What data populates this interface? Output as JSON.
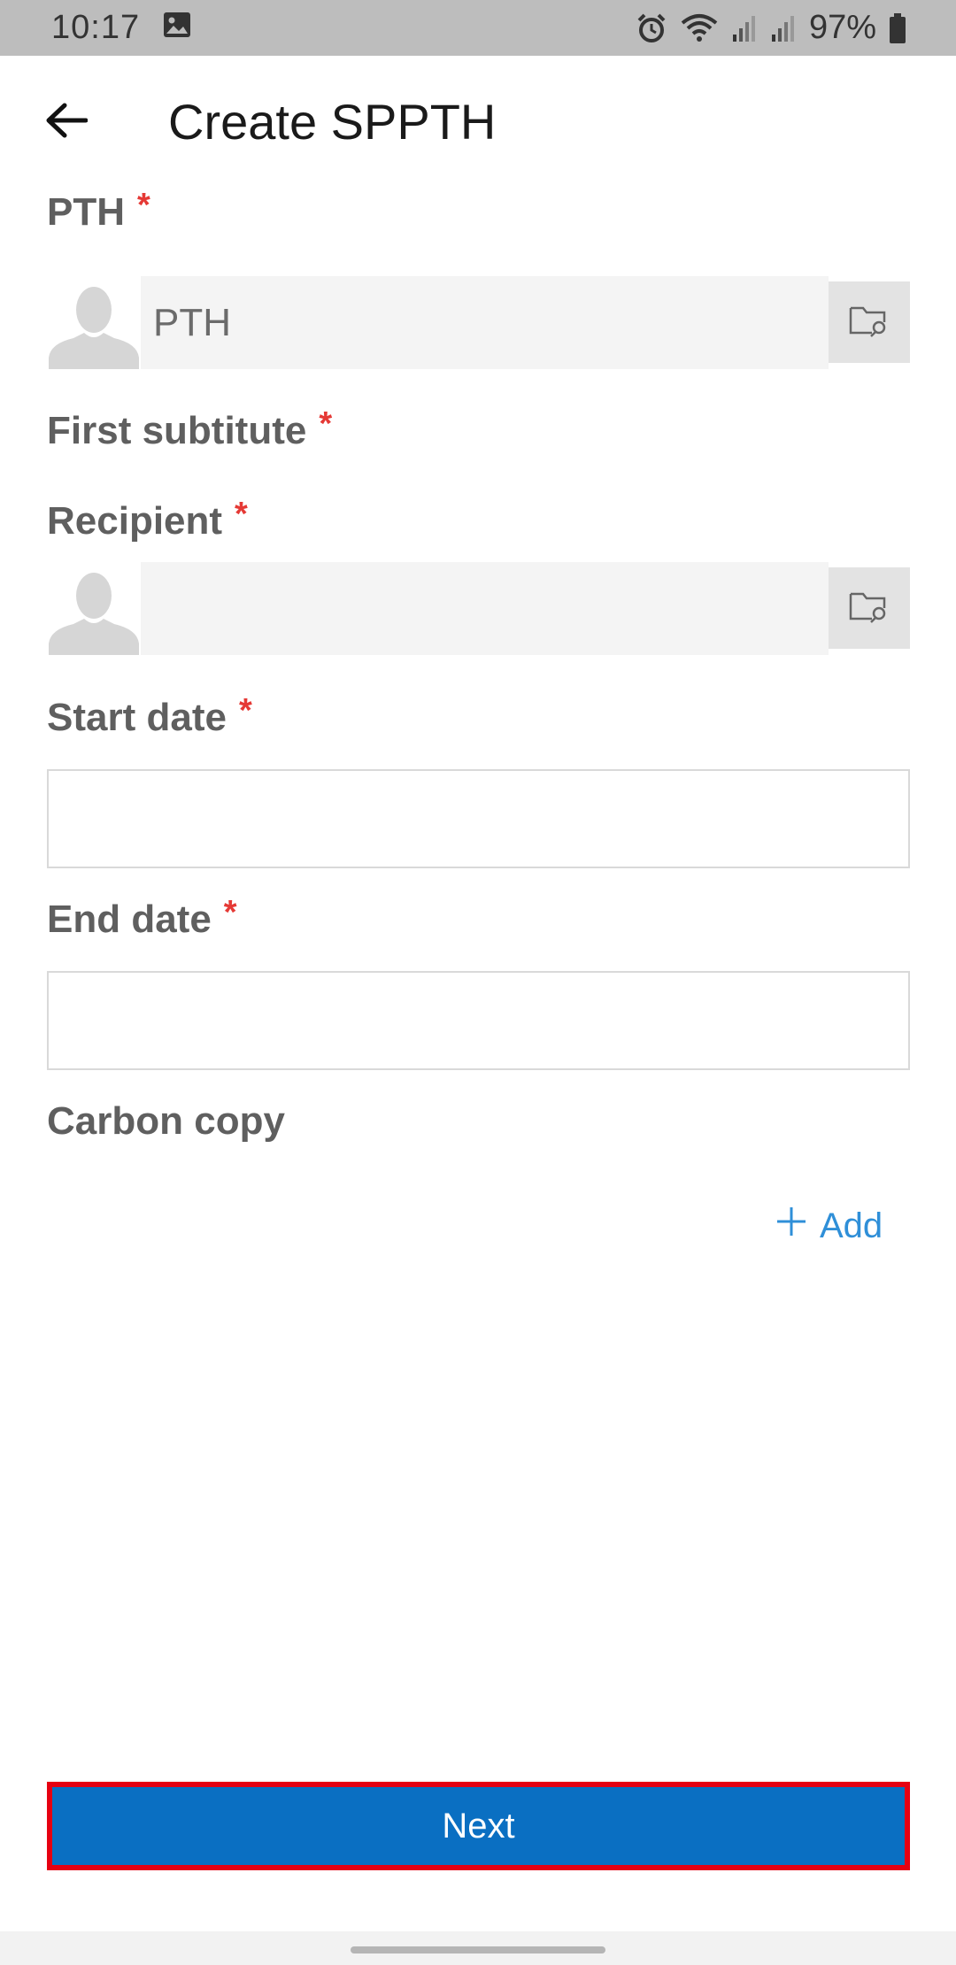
{
  "status_bar": {
    "time": "10:17",
    "battery": "97%",
    "icons": [
      "image-icon",
      "alarm-icon",
      "wifi-icon",
      "signal-icon",
      "signal-icon",
      "battery-icon"
    ]
  },
  "app_bar": {
    "title": "Create SPPTH",
    "back_icon": "arrow-left-icon"
  },
  "form": {
    "pth": {
      "label": "PTH",
      "required_mark": "*",
      "value": "PTH",
      "avatar_icon": "person-silhouette-icon",
      "picker_icon": "folder-search-icon"
    },
    "first_substitute": {
      "label": "First subtitute",
      "required_mark": "*"
    },
    "recipient": {
      "label": "Recipient",
      "required_mark": "*",
      "value": "",
      "avatar_icon": "person-silhouette-icon",
      "picker_icon": "folder-search-icon"
    },
    "start_date": {
      "label": "Start date",
      "required_mark": "*",
      "value": ""
    },
    "end_date": {
      "label": "End date",
      "required_mark": "*",
      "value": ""
    },
    "carbon_copy": {
      "label": "Carbon copy",
      "add_label": "Add",
      "add_icon": "plus-icon"
    }
  },
  "footer": {
    "next_label": "Next"
  },
  "colors": {
    "primary": "#0a6fc2",
    "highlight_border": "#e60012",
    "required": "#e53935",
    "link": "#2f8fd8"
  }
}
